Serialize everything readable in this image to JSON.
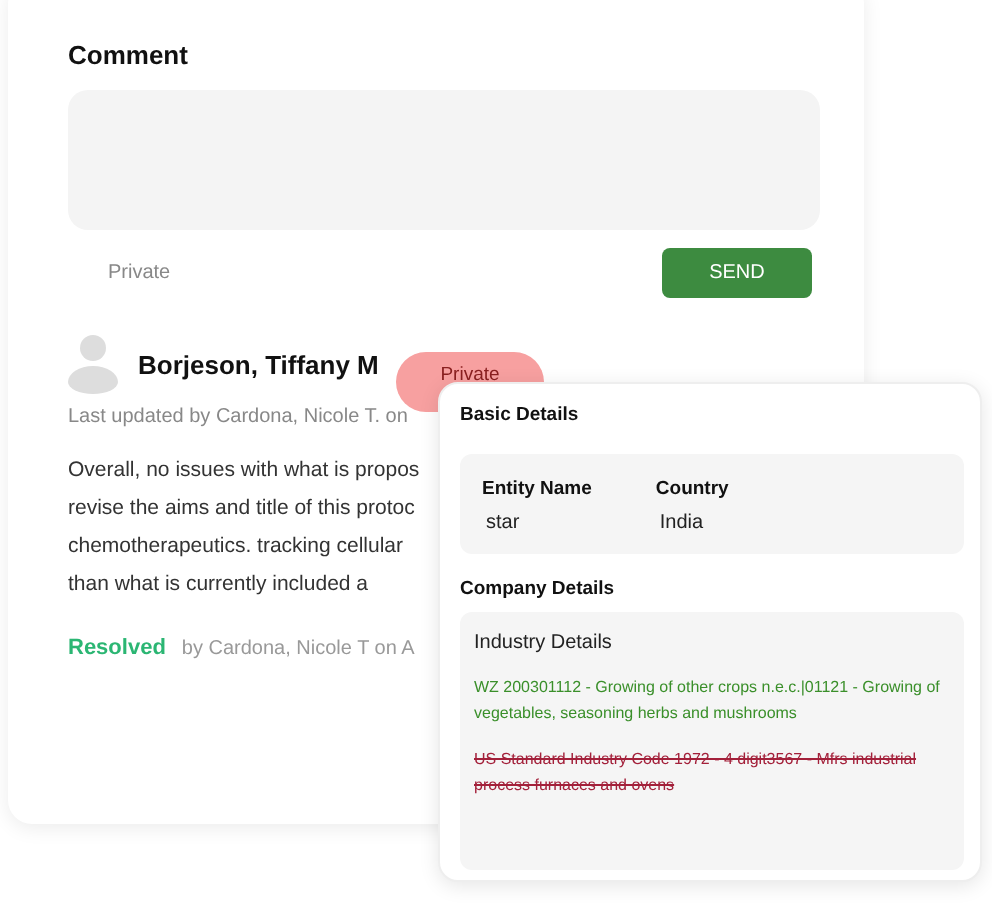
{
  "comment": {
    "title": "Comment",
    "private_label": "Private",
    "send": "SEND"
  },
  "entry": {
    "author": "Borjeson, Tiffany M",
    "badge": "Private",
    "updated": "Last updated by Cardona, Nicole T. on",
    "body": "Overall, no issues with what is propos\nrevise the aims and title of this protoc\nchemotherapeutics. tracking cellular\nthan what is currently included a",
    "status": "Resolved",
    "resolved_by": "by Cardona, Nicole T on A"
  },
  "details": {
    "basic_title": "Basic Details",
    "fields": [
      {
        "label": "Entity Name",
        "value": "star"
      },
      {
        "label": "Country",
        "value": "India"
      }
    ],
    "company_title": "Company Details",
    "industry_title": "Industry Details",
    "industries": [
      {
        "text": "WZ 200301112 - Growing of other crops n.e.c.|01121 - Growing of vegetables, seasoning herbs and mushrooms",
        "struck": false
      },
      {
        "text": "US Standard Industry Code 1972 - 4 digit3567 - Mfrs industrial process furnaces and ovens",
        "struck": true
      }
    ]
  }
}
